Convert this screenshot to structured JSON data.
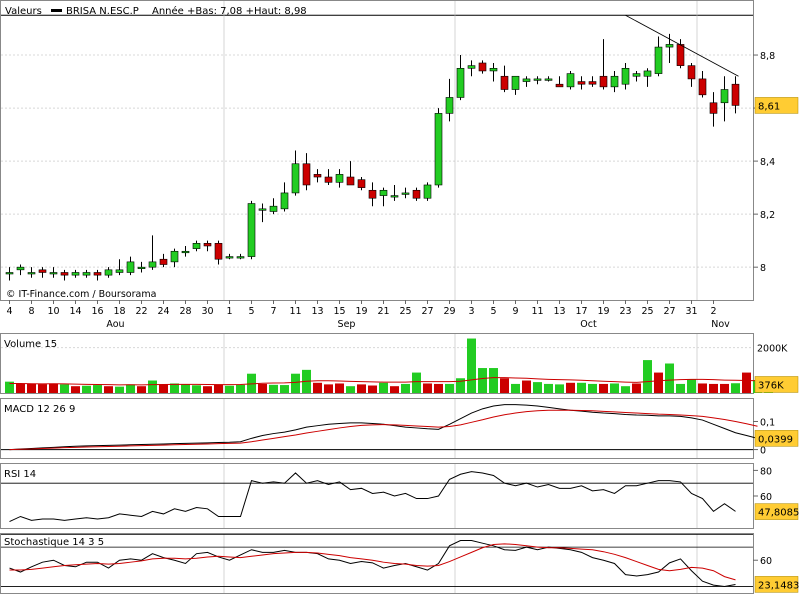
{
  "header": {
    "label": "Valeurs",
    "series_name": "BRISA N.ESC.P",
    "range_text": "Année +Bas: 7,08 +Haut: 8,98"
  },
  "footer": {
    "credit": "© IT-Finance.com / Boursorama"
  },
  "colors": {
    "up": "#22cc22",
    "down": "#cc0000",
    "badge": "#ffcc33",
    "macd": "#000000",
    "signal": "#cc0000"
  },
  "chart_data": [
    {
      "type": "candlestick",
      "title": "BRISA N.ESC.P",
      "ylim": [
        7.88,
        9.0
      ],
      "yticks": [
        8.0,
        8.2,
        8.4,
        8.6,
        8.8
      ],
      "ytick_labels": [
        "8",
        "8,2",
        "8,4",
        "8,6",
        "8,8"
      ],
      "last_value_label": "8,61",
      "x_tick_labels": [
        "4",
        "8",
        "10",
        "14",
        "16",
        "18",
        "22",
        "24",
        "28",
        "30",
        "1",
        "5",
        "7",
        "11",
        "13",
        "15",
        "19",
        "21",
        "25",
        "27",
        "29",
        "3",
        "5",
        "9",
        "11",
        "13",
        "17",
        "19",
        "23",
        "25",
        "27",
        "31",
        "2"
      ],
      "x_tick_index": [
        0,
        2,
        4,
        6,
        8,
        10,
        12,
        14,
        16,
        18,
        20,
        22,
        24,
        26,
        28,
        30,
        32,
        34,
        36,
        38,
        40,
        42,
        44,
        46,
        48,
        50,
        52,
        54,
        56,
        58,
        60,
        62,
        64
      ],
      "month_labels": [
        {
          "label": "Aou",
          "index": 9
        },
        {
          "label": "Sep",
          "index": 30
        },
        {
          "label": "Oct",
          "index": 52
        },
        {
          "label": "Nov",
          "index": 64
        }
      ],
      "candles": [
        {
          "o": 7.98,
          "h": 8.0,
          "l": 7.95,
          "c": 7.98
        },
        {
          "o": 7.99,
          "h": 8.01,
          "l": 7.97,
          "c": 8.0
        },
        {
          "o": 7.98,
          "h": 8.0,
          "l": 7.96,
          "c": 7.98
        },
        {
          "o": 7.99,
          "h": 8.0,
          "l": 7.96,
          "c": 7.98
        },
        {
          "o": 7.98,
          "h": 8.0,
          "l": 7.96,
          "c": 7.98
        },
        {
          "o": 7.98,
          "h": 7.99,
          "l": 7.95,
          "c": 7.97
        },
        {
          "o": 7.97,
          "h": 7.99,
          "l": 7.96,
          "c": 7.98
        },
        {
          "o": 7.97,
          "h": 7.99,
          "l": 7.96,
          "c": 7.98
        },
        {
          "o": 7.98,
          "h": 7.99,
          "l": 7.95,
          "c": 7.97
        },
        {
          "o": 7.97,
          "h": 8.0,
          "l": 7.96,
          "c": 7.99
        },
        {
          "o": 7.98,
          "h": 8.03,
          "l": 7.97,
          "c": 7.99
        },
        {
          "o": 7.98,
          "h": 8.04,
          "l": 7.97,
          "c": 8.02
        },
        {
          "o": 8.0,
          "h": 8.02,
          "l": 7.98,
          "c": 8.0
        },
        {
          "o": 8.0,
          "h": 8.12,
          "l": 7.99,
          "c": 8.02
        },
        {
          "o": 8.03,
          "h": 8.05,
          "l": 8.0,
          "c": 8.01
        },
        {
          "o": 8.02,
          "h": 8.07,
          "l": 8.0,
          "c": 8.06
        },
        {
          "o": 8.06,
          "h": 8.08,
          "l": 8.04,
          "c": 8.06
        },
        {
          "o": 8.07,
          "h": 8.1,
          "l": 8.06,
          "c": 8.09
        },
        {
          "o": 8.09,
          "h": 8.1,
          "l": 8.06,
          "c": 8.08
        },
        {
          "o": 8.09,
          "h": 8.1,
          "l": 8.01,
          "c": 8.03
        },
        {
          "o": 8.04,
          "h": 8.05,
          "l": 8.03,
          "c": 8.04
        },
        {
          "o": 8.04,
          "h": 8.05,
          "l": 8.03,
          "c": 8.04
        },
        {
          "o": 8.04,
          "h": 8.25,
          "l": 8.03,
          "c": 8.24
        },
        {
          "o": 8.22,
          "h": 8.24,
          "l": 8.17,
          "c": 8.22
        },
        {
          "o": 8.21,
          "h": 8.26,
          "l": 8.2,
          "c": 8.23
        },
        {
          "o": 8.22,
          "h": 8.32,
          "l": 8.21,
          "c": 8.28
        },
        {
          "o": 8.28,
          "h": 8.44,
          "l": 8.27,
          "c": 8.39
        },
        {
          "o": 8.39,
          "h": 8.43,
          "l": 8.29,
          "c": 8.31
        },
        {
          "o": 8.35,
          "h": 8.37,
          "l": 8.32,
          "c": 8.34
        },
        {
          "o": 8.34,
          "h": 8.37,
          "l": 8.31,
          "c": 8.32
        },
        {
          "o": 8.32,
          "h": 8.37,
          "l": 8.3,
          "c": 8.35
        },
        {
          "o": 8.34,
          "h": 8.4,
          "l": 8.31,
          "c": 8.31
        },
        {
          "o": 8.33,
          "h": 8.34,
          "l": 8.29,
          "c": 8.3
        },
        {
          "o": 8.29,
          "h": 8.32,
          "l": 8.23,
          "c": 8.26
        },
        {
          "o": 8.27,
          "h": 8.3,
          "l": 8.23,
          "c": 8.29
        },
        {
          "o": 8.27,
          "h": 8.31,
          "l": 8.25,
          "c": 8.27
        },
        {
          "o": 8.28,
          "h": 8.3,
          "l": 8.26,
          "c": 8.28
        },
        {
          "o": 8.29,
          "h": 8.3,
          "l": 8.25,
          "c": 8.26
        },
        {
          "o": 8.26,
          "h": 8.32,
          "l": 8.25,
          "c": 8.31
        },
        {
          "o": 8.31,
          "h": 8.6,
          "l": 8.3,
          "c": 8.58
        },
        {
          "o": 8.58,
          "h": 8.71,
          "l": 8.55,
          "c": 8.64
        },
        {
          "o": 8.64,
          "h": 8.8,
          "l": 8.63,
          "c": 8.75
        },
        {
          "o": 8.75,
          "h": 8.78,
          "l": 8.72,
          "c": 8.76
        },
        {
          "o": 8.77,
          "h": 8.78,
          "l": 8.73,
          "c": 8.74
        },
        {
          "o": 8.74,
          "h": 8.77,
          "l": 8.7,
          "c": 8.75
        },
        {
          "o": 8.72,
          "h": 8.76,
          "l": 8.66,
          "c": 8.67
        },
        {
          "o": 8.67,
          "h": 8.72,
          "l": 8.65,
          "c": 8.72
        },
        {
          "o": 8.7,
          "h": 8.72,
          "l": 8.68,
          "c": 8.71
        },
        {
          "o": 8.71,
          "h": 8.72,
          "l": 8.69,
          "c": 8.71
        },
        {
          "o": 8.71,
          "h": 8.72,
          "l": 8.7,
          "c": 8.71
        },
        {
          "o": 8.69,
          "h": 8.72,
          "l": 8.68,
          "c": 8.68
        },
        {
          "o": 8.68,
          "h": 8.74,
          "l": 8.67,
          "c": 8.73
        },
        {
          "o": 8.7,
          "h": 8.72,
          "l": 8.67,
          "c": 8.69
        },
        {
          "o": 8.7,
          "h": 8.72,
          "l": 8.68,
          "c": 8.69
        },
        {
          "o": 8.72,
          "h": 8.86,
          "l": 8.67,
          "c": 8.68
        },
        {
          "o": 8.68,
          "h": 8.74,
          "l": 8.66,
          "c": 8.72
        },
        {
          "o": 8.69,
          "h": 8.77,
          "l": 8.67,
          "c": 8.75
        },
        {
          "o": 8.72,
          "h": 8.74,
          "l": 8.7,
          "c": 8.73
        },
        {
          "o": 8.72,
          "h": 8.75,
          "l": 8.68,
          "c": 8.74
        },
        {
          "o": 8.73,
          "h": 8.87,
          "l": 8.72,
          "c": 8.83
        },
        {
          "o": 8.83,
          "h": 8.88,
          "l": 8.77,
          "c": 8.84
        },
        {
          "o": 8.84,
          "h": 8.86,
          "l": 8.75,
          "c": 8.76
        },
        {
          "o": 8.76,
          "h": 8.77,
          "l": 8.68,
          "c": 8.71
        },
        {
          "o": 8.71,
          "h": 8.74,
          "l": 8.64,
          "c": 8.65
        },
        {
          "o": 8.62,
          "h": 8.66,
          "l": 8.53,
          "c": 8.58
        },
        {
          "o": 8.62,
          "h": 8.72,
          "l": 8.55,
          "c": 8.67
        },
        {
          "o": 8.69,
          "h": 8.72,
          "l": 8.58,
          "c": 8.61
        }
      ],
      "trendline": [
        {
          "i": 56,
          "v": 8.95
        },
        {
          "i": 66,
          "v": 8.72
        }
      ]
    },
    {
      "type": "bar",
      "title": "Volume 15",
      "ylim": [
        0,
        2600
      ],
      "yticks": [
        2000
      ],
      "ytick_labels": [
        "2000K"
      ],
      "last_value_label": "376K",
      "values": [
        500,
        420,
        400,
        390,
        420,
        380,
        300,
        320,
        350,
        300,
        280,
        380,
        300,
        550,
        380,
        420,
        380,
        340,
        300,
        380,
        320,
        360,
        850,
        400,
        360,
        350,
        850,
        1020,
        450,
        380,
        420,
        300,
        380,
        330,
        450,
        300,
        400,
        900,
        420,
        400,
        400,
        650,
        2400,
        1100,
        1100,
        650,
        400,
        550,
        480,
        400,
        380,
        450,
        450,
        400,
        400,
        420,
        300,
        420,
        1450,
        900,
        1300,
        400,
        600,
        420,
        400,
        400,
        430,
        900,
        570,
        376
      ],
      "ma": [
        420,
        420,
        410,
        400,
        405,
        400,
        390,
        380,
        375,
        370,
        360,
        362,
        360,
        370,
        375,
        380,
        382,
        380,
        372,
        370,
        368,
        372,
        400,
        430,
        440,
        445,
        470,
        520,
        540,
        540,
        530,
        510,
        500,
        490,
        480,
        480,
        480,
        500,
        500,
        500,
        500,
        520,
        580,
        640,
        680,
        680,
        660,
        650,
        620,
        600,
        590,
        580,
        560,
        540,
        520,
        500,
        480,
        470,
        500,
        540,
        570,
        590,
        600,
        600,
        590,
        570,
        560,
        550,
        540,
        530
      ],
      "up": [
        1,
        0,
        0,
        0,
        0,
        1,
        0,
        1,
        1,
        0,
        1,
        1,
        0,
        1,
        0,
        1,
        1,
        1,
        0,
        0,
        1,
        1,
        1,
        0,
        1,
        1,
        1,
        1,
        0,
        0,
        0,
        1,
        0,
        0,
        1,
        0,
        1,
        1,
        0,
        0,
        1,
        1,
        1,
        1,
        1,
        0,
        1,
        0,
        1,
        1,
        1,
        0,
        1,
        1,
        0,
        1,
        1,
        0,
        1,
        0,
        1,
        1,
        1,
        0,
        0,
        0,
        1,
        0,
        1,
        1
      ]
    },
    {
      "type": "line",
      "title": "MACD 12 26 9",
      "ylim": [
        -0.03,
        0.18
      ],
      "yticks": [
        0,
        0.1
      ],
      "ytick_labels": [
        "0",
        "0,1"
      ],
      "last_value_label": "0,0399",
      "series": [
        {
          "values": [
            0.0,
            0.002,
            0.004,
            0.006,
            0.008,
            0.01,
            0.012,
            0.013,
            0.014,
            0.015,
            0.016,
            0.017,
            0.018,
            0.019,
            0.02,
            0.021,
            0.022,
            0.023,
            0.024,
            0.025,
            0.026,
            0.028,
            0.04,
            0.05,
            0.057,
            0.062,
            0.07,
            0.08,
            0.085,
            0.09,
            0.093,
            0.095,
            0.095,
            0.093,
            0.09,
            0.085,
            0.08,
            0.077,
            0.074,
            0.072,
            0.09,
            0.11,
            0.13,
            0.145,
            0.155,
            0.16,
            0.16,
            0.158,
            0.155,
            0.15,
            0.145,
            0.14,
            0.137,
            0.133,
            0.13,
            0.128,
            0.125,
            0.123,
            0.122,
            0.12,
            0.12,
            0.118,
            0.113,
            0.105,
            0.09,
            0.075,
            0.06,
            0.05,
            0.04
          ]
        },
        {
          "values": [
            0.0,
            0.001,
            0.002,
            0.004,
            0.005,
            0.007,
            0.008,
            0.009,
            0.01,
            0.011,
            0.012,
            0.013,
            0.014,
            0.015,
            0.016,
            0.017,
            0.018,
            0.019,
            0.02,
            0.021,
            0.022,
            0.023,
            0.028,
            0.034,
            0.04,
            0.046,
            0.052,
            0.059,
            0.065,
            0.071,
            0.077,
            0.082,
            0.086,
            0.088,
            0.089,
            0.088,
            0.086,
            0.084,
            0.082,
            0.08,
            0.082,
            0.088,
            0.097,
            0.106,
            0.116,
            0.124,
            0.13,
            0.135,
            0.138,
            0.14,
            0.14,
            0.14,
            0.139,
            0.138,
            0.136,
            0.134,
            0.132,
            0.13,
            0.128,
            0.126,
            0.125,
            0.123,
            0.121,
            0.118,
            0.113,
            0.107,
            0.1,
            0.092,
            0.083
          ]
        }
      ]
    },
    {
      "type": "line",
      "title": "RSI 14",
      "ylim": [
        35,
        85
      ],
      "yticks": [
        60,
        80
      ],
      "ytick_labels": [
        "60",
        "80"
      ],
      "hlines": [
        30,
        70
      ],
      "last_value_label": "47,8085",
      "series": [
        {
          "values": [
            40,
            44,
            41,
            42,
            42,
            41,
            42,
            43,
            42,
            43,
            46,
            45,
            44,
            48,
            46,
            50,
            48,
            51,
            50,
            44,
            44,
            44,
            72,
            70,
            71,
            70,
            78,
            70,
            72,
            69,
            71,
            65,
            66,
            62,
            63,
            60,
            62,
            58,
            58,
            60,
            73,
            77,
            79,
            78,
            76,
            70,
            68,
            70,
            67,
            69,
            66,
            66,
            68,
            64,
            65,
            62,
            68,
            68,
            70,
            72,
            72,
            71,
            62,
            58,
            48,
            54,
            48
          ]
        }
      ]
    },
    {
      "type": "line",
      "title": "Stochastique 14 3 5",
      "ylim": [
        10,
        100
      ],
      "yticks": [
        60
      ],
      "ytick_labels": [
        "60"
      ],
      "hlines": [
        20,
        80
      ],
      "last_value_label": "23,1483",
      "series": [
        {
          "values": [
            48,
            42,
            50,
            57,
            60,
            52,
            50,
            57,
            57,
            48,
            60,
            62,
            60,
            70,
            64,
            60,
            55,
            70,
            72,
            65,
            60,
            68,
            76,
            72,
            72,
            75,
            72,
            72,
            70,
            62,
            60,
            55,
            58,
            56,
            48,
            52,
            55,
            50,
            45,
            55,
            82,
            90,
            90,
            86,
            82,
            76,
            75,
            80,
            76,
            80,
            78,
            76,
            72,
            64,
            60,
            55,
            38,
            36,
            38,
            42,
            56,
            62,
            44,
            28,
            22,
            20,
            23
          ]
        },
        {
          "values": [
            45,
            45,
            46,
            48,
            50,
            52,
            53,
            54,
            55,
            54,
            55,
            57,
            59,
            62,
            63,
            63,
            62,
            63,
            65,
            66,
            65,
            64,
            66,
            68,
            70,
            71,
            72,
            72,
            71,
            69,
            67,
            64,
            62,
            60,
            57,
            55,
            54,
            52,
            51,
            52,
            58,
            65,
            72,
            79,
            84,
            85,
            84,
            82,
            80,
            79,
            79,
            78,
            77,
            76,
            73,
            69,
            64,
            58,
            52,
            46,
            44,
            46,
            49,
            48,
            44,
            35,
            30
          ]
        }
      ]
    }
  ]
}
